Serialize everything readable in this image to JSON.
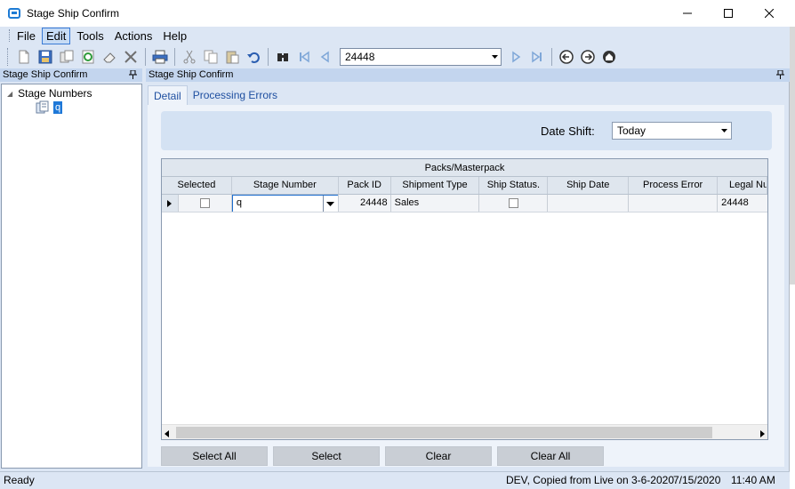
{
  "window": {
    "title": "Stage Ship Confirm"
  },
  "menu": {
    "items": [
      "File",
      "Edit",
      "Tools",
      "Actions",
      "Help"
    ],
    "active": "Edit"
  },
  "toolbar": {
    "record_value": "24448",
    "icons": [
      "new-icon",
      "save-icon",
      "copy-record-icon",
      "refresh-icon",
      "erase-icon",
      "delete-icon",
      "print-icon",
      "cut-icon",
      "copy-icon",
      "paste-icon",
      "undo-icon",
      "find-icon",
      "first-record-icon",
      "previous-record-icon",
      "next-record-icon",
      "last-record-icon",
      "back-icon",
      "forward-icon",
      "home-icon"
    ]
  },
  "left_panel": {
    "header": "Stage Ship Confirm",
    "tree": {
      "root_label": "Stage Numbers",
      "child_label": "q"
    }
  },
  "right_panel": {
    "header": "Stage Ship Confirm",
    "tabs": [
      "Detail",
      "Processing Errors"
    ],
    "selected_tab": "Detail",
    "date_shift": {
      "label": "Date Shift:",
      "value": "Today"
    },
    "grid": {
      "caption": "Packs/Masterpack",
      "columns": [
        "Selected",
        "Stage Number",
        "Pack ID",
        "Shipment Type",
        "Ship Status.",
        "Ship Date",
        "Process Error",
        "Legal Nu"
      ],
      "rows": [
        {
          "selected": false,
          "stage_number": "q",
          "pack_id": "24448",
          "shipment_type": "Sales",
          "ship_status": false,
          "ship_date": "",
          "process_error": "",
          "legal_number": "24448"
        }
      ]
    },
    "buttons": [
      "Select All",
      "Select",
      "Clear",
      "Clear All"
    ]
  },
  "status": {
    "left": "Ready",
    "environment": "DEV, Copied from Live on 3-6-2020",
    "date": "7/15/2020",
    "time": "11:40 AM"
  },
  "colors": {
    "chrome": "#dce6f4",
    "header": "#c3d5ee",
    "selection": "#1e78d8",
    "tab_text": "#1e4fa0"
  }
}
